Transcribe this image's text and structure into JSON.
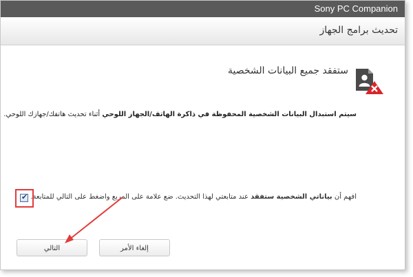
{
  "window": {
    "app_title": "Sony PC Companion",
    "page_title": "تحديث برامج الجهاز"
  },
  "warning": {
    "icon": "contact-delete-icon",
    "heading": "ستفقد جميع البيانات الشخصية",
    "description_bold": "سيتم استبدال البيانات الشخصية المحفوظة في ذاكرة الهاتف/الجهاز اللوحي",
    "description_rest": " أثناء تحديث هاتفك/جهازك اللوحي."
  },
  "acknowledgement": {
    "part1": "افهم أن ",
    "part_bold": "بياناتي الشخصية ستفقد",
    "part2": " عند متابعتي لهذا التحديث. ضع علامة على المربع واضغط على التالي للمتابعة.",
    "checked": true
  },
  "buttons": {
    "next_label": "التالي",
    "cancel_label": "إلغاء الأمر"
  },
  "colors": {
    "titlebar": "#5a5a5a",
    "highlight": "#e23b3b"
  }
}
